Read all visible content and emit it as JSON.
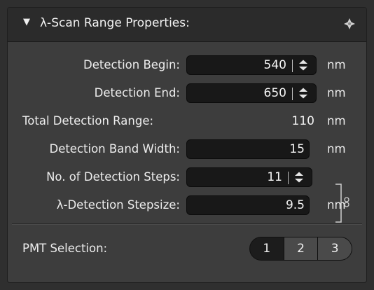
{
  "panel": {
    "title": "λ-Scan Range Properties:",
    "collapse_glyph": "▼",
    "pin_icon": "pin-icon"
  },
  "rows": {
    "detection_begin": {
      "label": "Detection Begin:",
      "value": "540",
      "unit": "nm"
    },
    "detection_end": {
      "label": "Detection End:",
      "value": "650",
      "unit": "nm"
    },
    "total_range": {
      "label": "Total Detection Range:",
      "value": "110",
      "unit": "nm"
    },
    "band_width": {
      "label": "Detection Band Width:",
      "value": "15",
      "unit": "nm"
    },
    "steps": {
      "label": "No. of Detection Steps:",
      "value": "11"
    },
    "stepsize": {
      "label": "λ-Detection Stepsize:",
      "value": "9.5",
      "unit": "nm"
    }
  },
  "pmt": {
    "label": "PMT Selection:",
    "options": [
      "1",
      "2",
      "3"
    ],
    "selected": [
      "2",
      "3"
    ]
  },
  "colors": {
    "panel_bg": "#3d3d3d",
    "header_bg": "#2b2b2b",
    "field_bg": "#181818",
    "text": "#ececec"
  }
}
